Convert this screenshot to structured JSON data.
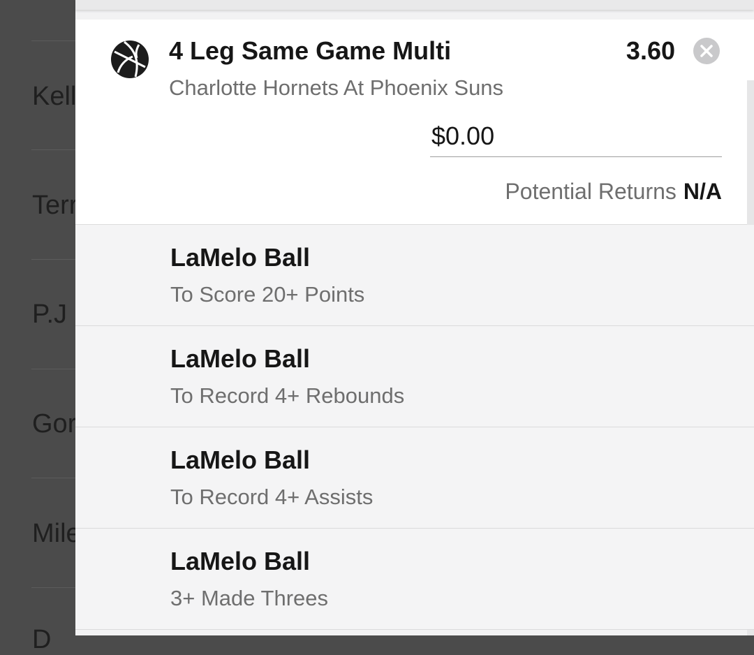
{
  "background_list": {
    "items": [
      "Kell",
      "Terr",
      "P.J",
      "Gor",
      "Mile",
      "D"
    ]
  },
  "bet_slip": {
    "icon": "basketball-icon",
    "title": "4 Leg Same Game Multi",
    "subtitle": "Charlotte Hornets At Phoenix Suns",
    "odds": "3.60",
    "stake_value": "$0.00",
    "potential_returns_label": "Potential Returns",
    "potential_returns_value": "N/A",
    "legs": [
      {
        "player": "LaMelo Ball",
        "market": "To Score 20+ Points"
      },
      {
        "player": "LaMelo Ball",
        "market": "To Record 4+ Rebounds"
      },
      {
        "player": "LaMelo Ball",
        "market": "To Record 4+ Assists"
      },
      {
        "player": "LaMelo Ball",
        "market": "3+ Made Threes"
      }
    ]
  }
}
